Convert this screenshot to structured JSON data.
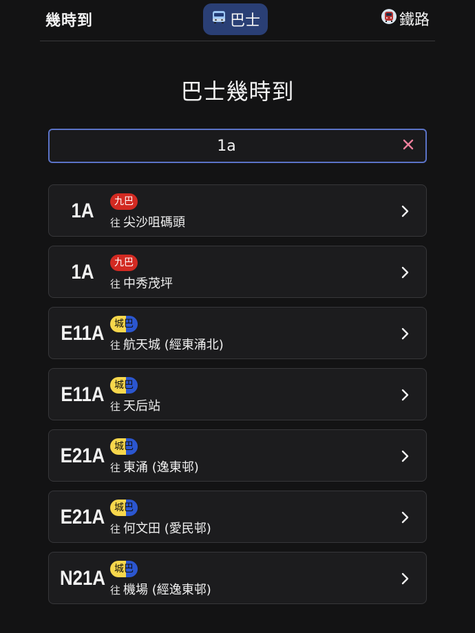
{
  "header": {
    "brand": "幾時到",
    "tabs": {
      "bus": {
        "label": "巴士",
        "icon": "bus-icon"
      },
      "rail": {
        "label": "鐵路",
        "icon": "train-icon"
      }
    }
  },
  "main": {
    "title": "巴士幾時到",
    "search": {
      "value": "1a",
      "clear_icon": "close-icon"
    },
    "results": [
      {
        "route": "1A",
        "operator": "九巴",
        "operator_style": "kmb",
        "prefix": "往",
        "destination": "尖沙咀碼頭"
      },
      {
        "route": "1A",
        "operator": "九巴",
        "operator_style": "kmb",
        "prefix": "往",
        "destination": "中秀茂坪"
      },
      {
        "route": "E11A",
        "operator": "城巴",
        "operator_style": "ctb",
        "prefix": "往",
        "destination": "航天城 (經東涌北)"
      },
      {
        "route": "E11A",
        "operator": "城巴",
        "operator_style": "ctb",
        "prefix": "往",
        "destination": "天后站"
      },
      {
        "route": "E21A",
        "operator": "城巴",
        "operator_style": "ctb",
        "prefix": "往",
        "destination": "東涌 (逸東邨)"
      },
      {
        "route": "E21A",
        "operator": "城巴",
        "operator_style": "ctb",
        "prefix": "往",
        "destination": "何文田 (愛民邨)"
      },
      {
        "route": "N21A",
        "operator": "城巴",
        "operator_style": "ctb",
        "prefix": "往",
        "destination": "機場 (經逸東邨)"
      }
    ]
  },
  "colors": {
    "background": "#131314",
    "card": "#1c1c1e",
    "active_tab": "#2a3f75",
    "search_border": "#5b73c7",
    "kmb_red": "#d22a22",
    "ctb_yellow": "#f7d74c",
    "ctb_blue": "#2b56cf",
    "clear_pink": "#f07f9c"
  }
}
